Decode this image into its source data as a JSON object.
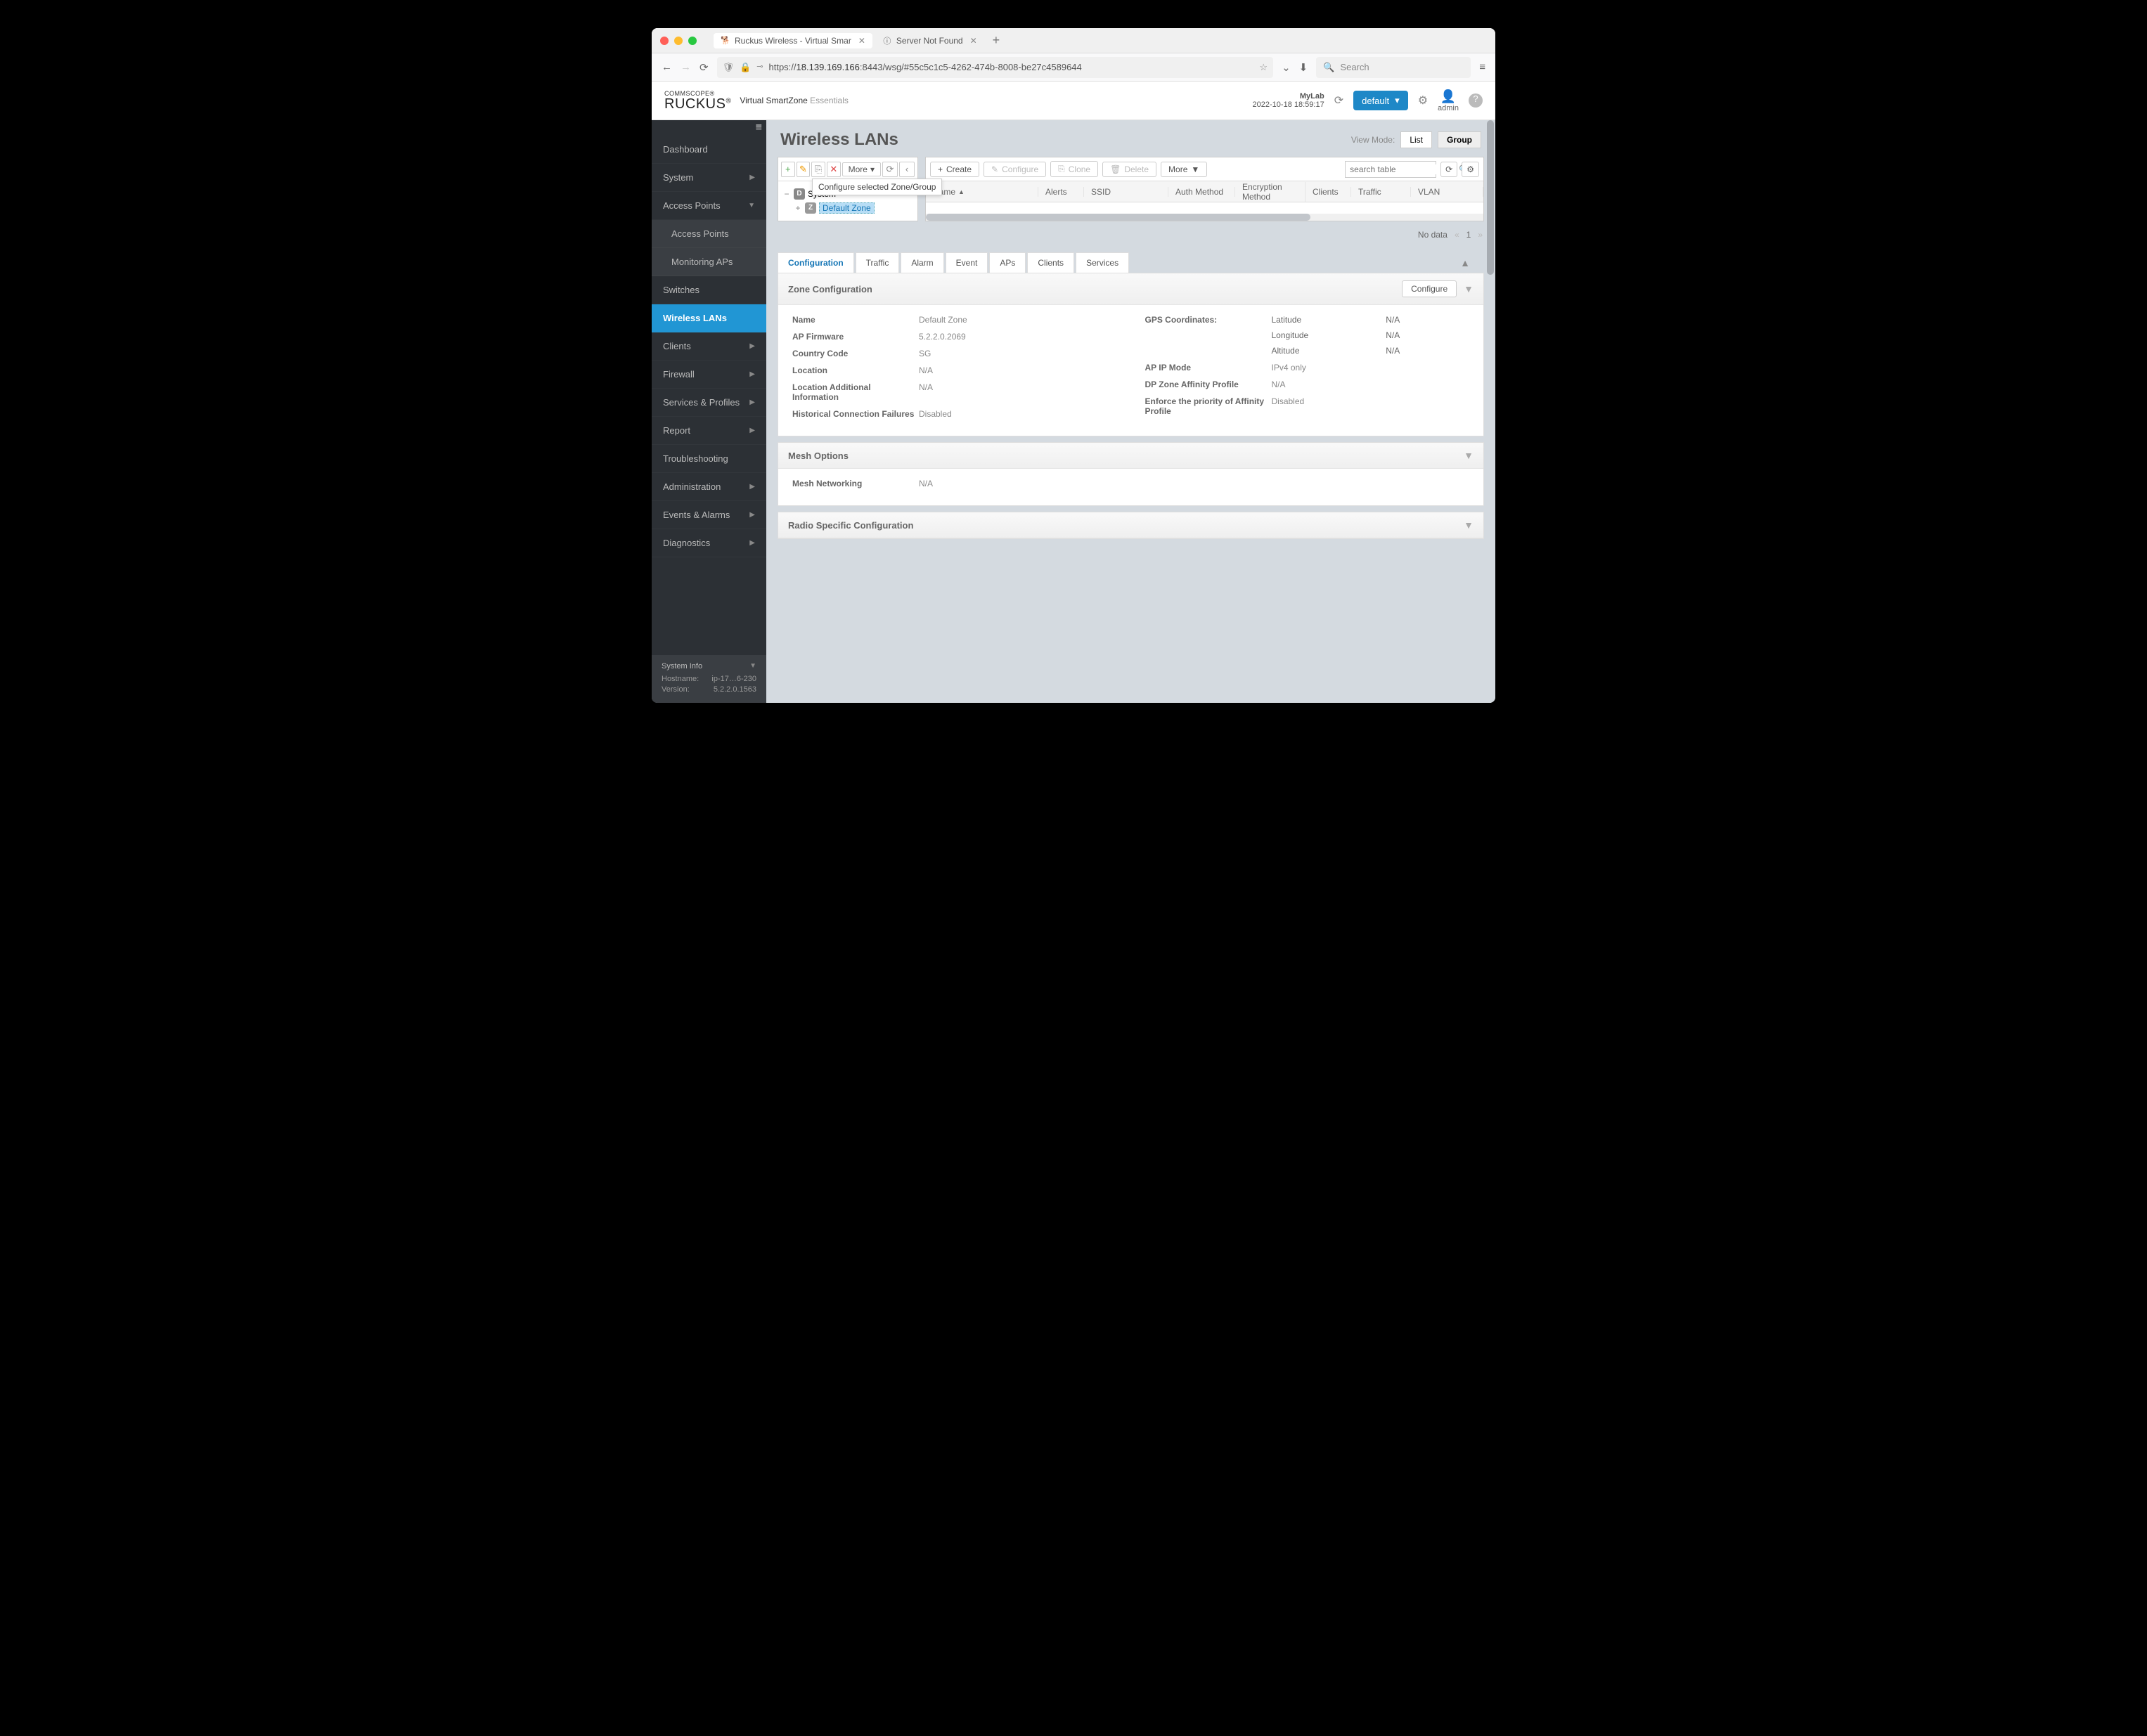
{
  "browser": {
    "tabs": [
      {
        "favicon": "🐦",
        "title": "Ruckus Wireless - Virtual Smar"
      },
      {
        "favicon": "ⓘ",
        "title": "Server Not Found"
      }
    ],
    "url_prefix": "https://",
    "url_host": "18.139.169.166",
    "url_path": ":8443/wsg/#55c5c1c5-4262-474b-8008-be27c4589644",
    "search_placeholder": "Search"
  },
  "header": {
    "brand_top": "COMMSCOPE®",
    "brand_main": "RUCKUS",
    "brand_sub": "Virtual SmartZone",
    "brand_sub_light": "Essentials",
    "lab_name": "MyLab",
    "lab_time": "2022-10-18  18:59:17",
    "dropdown": "default",
    "user": "admin"
  },
  "sidebar": {
    "items": [
      "Dashboard",
      "System",
      "Access Points",
      "Access Points",
      "Monitoring APs",
      "Switches",
      "Wireless LANs",
      "Clients",
      "Firewall",
      "Services & Profiles",
      "Report",
      "Troubleshooting",
      "Administration",
      "Events & Alarms",
      "Diagnostics"
    ],
    "sys_info_title": "System Info",
    "hostname_label": "Hostname:",
    "hostname_value": "ip-17…6-230",
    "version_label": "Version:",
    "version_value": "5.2.2.0.1563"
  },
  "page": {
    "title": "Wireless LANs",
    "view_mode_label": "View Mode:",
    "view_list": "List",
    "view_group": "Group"
  },
  "tree_toolbar": {
    "more": "More",
    "tooltip": "Configure selected Zone/Group"
  },
  "tree": {
    "root": "System",
    "zone": "Default Zone"
  },
  "grid_toolbar": {
    "create": "Create",
    "configure": "Configure",
    "clone": "Clone",
    "delete": "Delete",
    "more": "More",
    "search_placeholder": "search table"
  },
  "grid_columns": [
    "Name",
    "Alerts",
    "SSID",
    "Auth Method",
    "Encryption Method",
    "Clients",
    "Traffic",
    "VLAN"
  ],
  "pager": {
    "no_data": "No data",
    "page": "1"
  },
  "tabs": [
    "Configuration",
    "Traffic",
    "Alarm",
    "Event",
    "APs",
    "Clients",
    "Services"
  ],
  "zone_config": {
    "title": "Zone Configuration",
    "configure_btn": "Configure",
    "left": [
      {
        "k": "Name",
        "v": "Default Zone"
      },
      {
        "k": "AP Firmware",
        "v": "5.2.2.0.2069"
      },
      {
        "k": "Country Code",
        "v": "SG"
      },
      {
        "k": "Location",
        "v": "N/A"
      },
      {
        "k": "Location Additional Information",
        "v": "N/A"
      },
      {
        "k": "Historical Connection Failures",
        "v": "Disabled"
      }
    ],
    "gps_label": "GPS Coordinates:",
    "gps": [
      {
        "k": "Latitude",
        "v": "N/A"
      },
      {
        "k": "Longitude",
        "v": "N/A"
      },
      {
        "k": "Altitude",
        "v": "N/A"
      }
    ],
    "right": [
      {
        "k": "AP IP Mode",
        "v": "IPv4 only"
      },
      {
        "k": "DP Zone Affinity Profile",
        "v": "N/A"
      },
      {
        "k": "Enforce the priority of Affinity Profile",
        "v": "Disabled"
      }
    ]
  },
  "mesh": {
    "title": "Mesh Options",
    "networking_label": "Mesh Networking",
    "networking_value": "N/A"
  },
  "radio": {
    "title": "Radio Specific Configuration"
  }
}
